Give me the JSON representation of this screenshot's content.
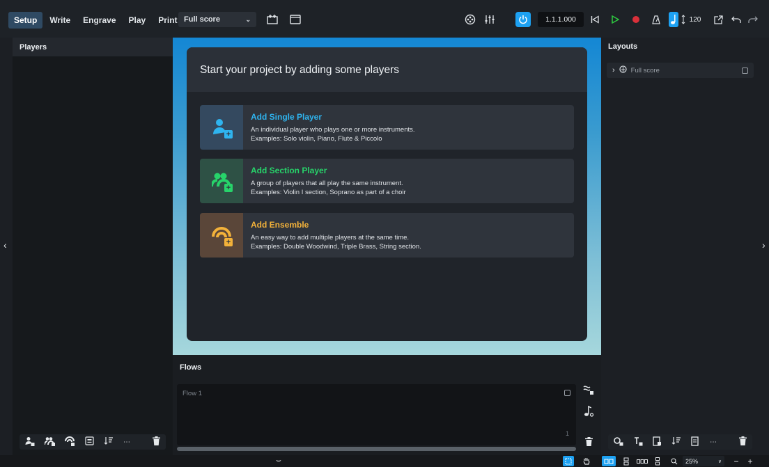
{
  "toolbar": {
    "modes": [
      "Setup",
      "Write",
      "Engrave",
      "Play",
      "Print"
    ],
    "active_mode": "Setup",
    "layout_select": "Full score",
    "counter": "1.1.1.000",
    "tempo": "120"
  },
  "left_panel": {
    "title": "Players"
  },
  "dialog": {
    "title": "Start your project by adding some players",
    "cards": [
      {
        "title": "Add Single Player",
        "line1": "An individual player who plays one or more instruments.",
        "line2": "Examples: Solo violin, Piano, Flute & Piccolo",
        "accent": "#2fb4ef",
        "bg": "#34495f"
      },
      {
        "title": "Add Section Player",
        "line1": "A group of players that all play the same instrument.",
        "line2": "Examples: Violin I section, Soprano as part of a choir",
        "accent": "#27d36a",
        "bg": "#2e5145"
      },
      {
        "title": "Add Ensemble",
        "line1": "An easy way to add multiple players at the same time.",
        "line2": "Examples: Double Woodwind, Triple Brass, String section.",
        "accent": "#f3b23a",
        "bg": "#5a4639"
      }
    ]
  },
  "flows": {
    "title": "Flows",
    "items": [
      {
        "label": "Flow 1",
        "number": "1"
      }
    ]
  },
  "right_panel": {
    "title": "Layouts",
    "items": [
      {
        "label": "Full score"
      }
    ]
  },
  "status": {
    "zoom": "25%"
  },
  "colors": {
    "accent": "#1da1f2",
    "record": "#d9303a",
    "play": "#2ecc40"
  }
}
